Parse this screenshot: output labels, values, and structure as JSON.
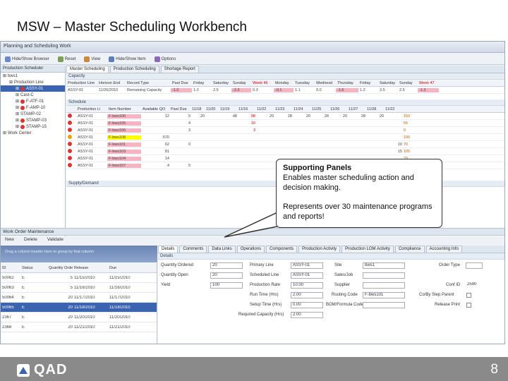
{
  "slide_title": "MSW – Master Scheduling Workbench",
  "window_title": "Planning and Scheduling Work",
  "toolbar": {
    "items": [
      "Hide/Show Browser",
      "Reset",
      "View",
      "Hide/Show Item",
      "Options"
    ]
  },
  "left_panel": {
    "tabs": [
      "Production Scheduler"
    ],
    "nodes": [
      {
        "label": "bws1",
        "indent": 0,
        "dot": ""
      },
      {
        "label": "Production Line",
        "indent": 1,
        "dot": ""
      },
      {
        "label": "ASSY-01",
        "indent": 2,
        "dot": "#d33",
        "selected": true
      },
      {
        "label": "Cast-C",
        "indent": 2,
        "dot": ""
      },
      {
        "label": "F-ATF-01",
        "indent": 2,
        "dot": "#d33"
      },
      {
        "label": "F-AMP-10",
        "indent": 2,
        "dot": "#d33"
      },
      {
        "label": "STAMP-02",
        "indent": 2,
        "dot": ""
      },
      {
        "label": "STAMP-03",
        "indent": 2,
        "dot": "#d33"
      },
      {
        "label": "STAMP-15",
        "indent": 2,
        "dot": "#d33"
      },
      {
        "label": "Work Center",
        "indent": 0,
        "dot": ""
      }
    ]
  },
  "tabs": [
    "Master Scheduling",
    "Production Scheduling",
    "Shortage Report"
  ],
  "capacity": {
    "section": "Capacity",
    "headers": [
      "Production Line",
      "Horizon End",
      "Record Type",
      "Past Due",
      "Friday",
      "Saturday",
      "Sunday",
      "Week 46",
      "Monday",
      "Tuesday",
      "Wednesd",
      "Thursday",
      "Friday",
      "Saturday",
      "Sunday",
      "Week 47"
    ],
    "row": [
      "ASSY-01",
      "11/26/2010",
      "Remaining Capacity",
      "-1.0",
      "1.0",
      "2.5",
      "-2.3",
      "0.3",
      "-0.1",
      "1.1",
      "0.0",
      "-1.6",
      "1.2",
      "3.5",
      "2.5",
      "-1.3"
    ]
  },
  "schedule": {
    "section": "Schedule",
    "headers": [
      "",
      "Production Li",
      "Item Number",
      "Available QO",
      "Past Due",
      "11/18",
      "11/20",
      "11/19",
      "11/16",
      "11/22",
      "11/23",
      "11/24",
      "11/25",
      "11/26",
      "11/27",
      "11/28",
      "11/22"
    ],
    "rows": [
      {
        "dot": "#d33",
        "line": "ASSY-01",
        "item": "F-bws100",
        "qty": "12",
        "pd": "5",
        "v": [
          "20",
          "",
          "48",
          "98",
          "20",
          "28",
          "20",
          "28",
          "20",
          "28",
          "20",
          "",
          "150"
        ]
      },
      {
        "dot": "#d33",
        "line": "ASSY-01",
        "item": "F-bws105",
        "qty": "",
        "pd": "4",
        "v": [
          "",
          "",
          "",
          "10",
          "",
          "",
          "",
          "",
          "",
          "",
          "",
          "",
          "55"
        ]
      },
      {
        "dot": "#d33",
        "line": "ASSY-01",
        "item": "F-bws106",
        "qty": "",
        "pd": "3",
        "v": [
          "",
          "",
          "",
          "3",
          "",
          "",
          "",
          "",
          "",
          "",
          "",
          "",
          "0"
        ]
      },
      {
        "dot": "#e9a100",
        "line": "ASSY-01",
        "item": "F-bws108",
        "qty": "570",
        "pd": "",
        "v": [
          "",
          "",
          "",
          "",
          "",
          "",
          "",
          "",
          "",
          "",
          "",
          "",
          "106"
        ]
      },
      {
        "dot": "#d33",
        "line": "ASSY-01",
        "item": "F-bws101",
        "qty": "62",
        "pd": "0",
        "v": [
          "",
          "",
          "",
          "",
          "",
          "",
          "",
          "",
          "",
          "",
          "",
          "10",
          "70"
        ]
      },
      {
        "dot": "#d33",
        "line": "ASSY-01",
        "item": "F-bws103",
        "qty": "81",
        "pd": "",
        "v": [
          "",
          "",
          "",
          "",
          "",
          "",
          "",
          "",
          "",
          "",
          "",
          "15",
          "105"
        ]
      },
      {
        "dot": "#d33",
        "line": "ASSY-01",
        "item": "F-bws104",
        "qty": "14",
        "pd": "",
        "v": [
          "",
          "",
          "",
          "",
          "",
          "",
          "",
          "",
          "",
          "",
          "",
          "",
          "33"
        ]
      },
      {
        "dot": "#d33",
        "line": "ASSY-01",
        "item": "F-bws107",
        "qty": "4",
        "pd": "5",
        "v": [
          "",
          "",
          "",
          "",
          "",
          "",
          "",
          "",
          "",
          "",
          "",
          "",
          "23"
        ]
      }
    ],
    "footer": "Supply/Demand"
  },
  "callout": {
    "heading": "Supporting Panels",
    "line1": "Enables master scheduling action and decision making.",
    "line2": "Represents over 30 maintenance programs and reports!"
  },
  "work_order": {
    "title": "Work Order Maintenance",
    "toolbar": [
      "New",
      "Delete",
      "Validate"
    ],
    "group_hint": "Drag a column header here to group by that column",
    "columns": [
      "ID",
      "Status",
      "Quantity Ordered",
      "Release",
      "Due"
    ],
    "rows": [
      {
        "id": "50062",
        "status": "E",
        "qty": "5",
        "rel": "11/15/2010",
        "due": "11/15/2010",
        "sel": false
      },
      {
        "id": "50063",
        "status": "E",
        "qty": "5",
        "rel": "11/16/2010",
        "due": "11/16/2010",
        "sel": false
      },
      {
        "id": "50064",
        "status": "E",
        "qty": "20",
        "rel": "11/17/2010",
        "due": "11/17/2010",
        "sel": false
      },
      {
        "id": "50065",
        "status": "E",
        "qty": "20",
        "rel": "11/18/2010",
        "due": "11/18/2010",
        "sel": true
      },
      {
        "id": "2367",
        "status": "E",
        "qty": "20",
        "rel": "11/20/2010",
        "due": "11/20/2010",
        "sel": false
      },
      {
        "id": "2368",
        "status": "E",
        "qty": "20",
        "rel": "11/21/2010",
        "due": "11/21/2010",
        "sel": false
      }
    ],
    "detail_tabs": [
      "Details",
      "Comments",
      "Data Links",
      "Operations",
      "Components",
      "Production Activity",
      "Production LOM Activity",
      "Compliance",
      "Accounting Info"
    ],
    "details_label": "Details",
    "fields": {
      "qty_ordered_label": "Quantity Ordered",
      "qty_ordered": "20",
      "qty_open_label": "Quantity Open",
      "qty_open": "20",
      "yield_label": "Yield",
      "yield": "100",
      "primary_line_label": "Primary Line",
      "primary_line": "ASSY-01",
      "scheduled_line_label": "Scheduled Line",
      "scheduled_line": "ASSY-01",
      "production_rate_label": "Production Rate",
      "production_rate": "10.00",
      "run_time_label": "Run Time (Hrs)",
      "run_time": "2.00",
      "setup_time_label": "Setup Time (Hrs)",
      "setup_time": "0.00",
      "req_capacity_label": "Required Capacity (Hrs)",
      "req_capacity": "2.00",
      "site_label": "Site",
      "site": "bws1",
      "sales_job_label": "Sales/Job",
      "sales_job": "",
      "supplier_label": "Supplier",
      "supplier": "",
      "routing_code_label": "Routing Code",
      "routing_code": "F-bws101",
      "bom_label": "BOM/Formula Code",
      "bom": "",
      "order_type_label": "Order Type",
      "order_type": "",
      "conf_id_label": "Conf ID",
      "conf_id": "2590",
      "cotlot_label": "Co/By Step Parent",
      "release_print_label": "Release Print"
    }
  },
  "footer": {
    "logo": "QAD",
    "page": "8"
  }
}
